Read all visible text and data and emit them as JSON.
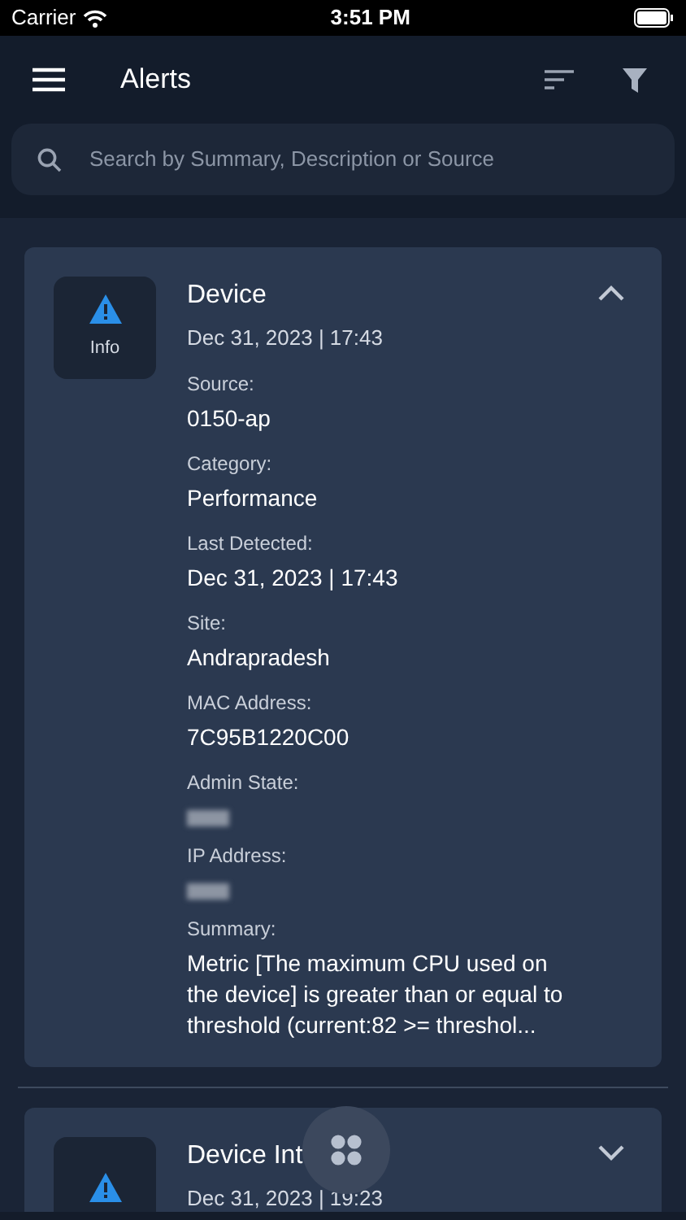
{
  "status_bar": {
    "carrier": "Carrier",
    "time": "3:51 PM"
  },
  "header": {
    "title": "Alerts"
  },
  "search": {
    "placeholder": "Search by Summary, Description or Source"
  },
  "alerts": [
    {
      "title": "Device",
      "severity": "Info",
      "date": "Dec 31, 2023 | 17:43",
      "expanded": true,
      "fields": [
        {
          "label": "Source:",
          "value": "0150-ap",
          "kind": "text"
        },
        {
          "label": "Category:",
          "value": "Performance",
          "kind": "text"
        },
        {
          "label": "Last Detected:",
          "value": "Dec 31, 2023 | 17:43",
          "kind": "text"
        },
        {
          "label": "Site:",
          "value": "Andrapradesh",
          "kind": "text"
        },
        {
          "label": "MAC Address:",
          "value": "7C95B1220C00",
          "kind": "text"
        },
        {
          "label": "Admin State:",
          "kind": "redacted"
        },
        {
          "label": "IP Address:",
          "kind": "redacted"
        },
        {
          "label": "Summary:",
          "value": "Metric [The maximum CPU used on the device] is greater than or equal to threshold (current:82 >= threshol...",
          "kind": "text"
        }
      ]
    },
    {
      "title": "Device Int",
      "date": "Dec 31, 2023 | 19:23",
      "expanded": false
    }
  ]
}
